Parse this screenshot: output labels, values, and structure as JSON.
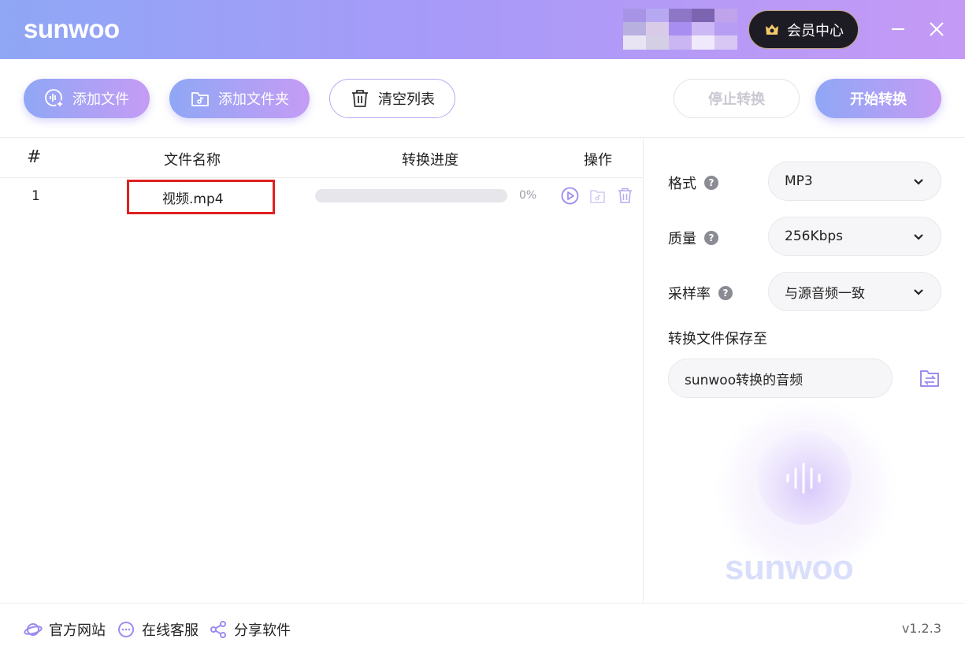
{
  "app": {
    "logo": "sunwoo",
    "version": "v1.2.3"
  },
  "header": {
    "vip_label": "会员中心"
  },
  "toolbar": {
    "add_file": "添加文件",
    "add_folder": "添加文件夹",
    "clear_list": "清空列表",
    "stop_convert": "停止转换",
    "start_convert": "开始转换"
  },
  "table": {
    "columns": [
      "#",
      "文件名称",
      "转换进度",
      "操作"
    ],
    "rows": [
      {
        "index": "1",
        "name": "视频.mp4",
        "progress_text": "0%",
        "progress": 0
      }
    ]
  },
  "settings": {
    "format_label": "格式",
    "format_value": "MP3",
    "quality_label": "质量",
    "quality_value": "256Kbps",
    "samplerate_label": "采样率",
    "samplerate_value": "与源音频一致",
    "save_label": "转换文件保存至",
    "save_path": "sunwoo转换的音频",
    "watermark": "sunwoo"
  },
  "footer": {
    "website": "官方网站",
    "support": "在线客服",
    "share": "分享软件"
  },
  "colors": {
    "accent_start": "#8fa7f5",
    "accent_end": "#c59cf5",
    "highlight": "#e02020"
  }
}
